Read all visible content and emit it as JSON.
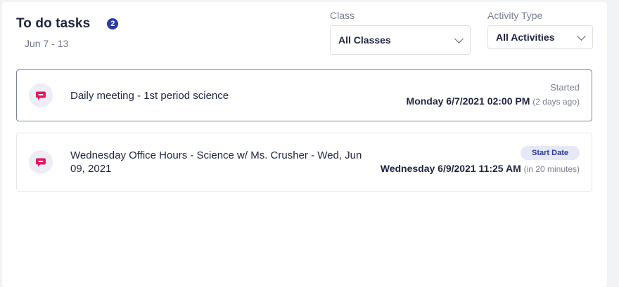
{
  "header": {
    "title": "To do tasks",
    "badge_count": "2",
    "date_range": "Jun 7 - 13"
  },
  "filters": {
    "class": {
      "label": "Class",
      "value": "All Classes"
    },
    "activity_type": {
      "label": "Activity Type",
      "value": "All Activities"
    }
  },
  "tasks": [
    {
      "title": "Daily meeting - 1st period science",
      "status_label": "Started",
      "datetime": "Monday 6/7/2021 02:00 PM",
      "relative": "(2 days ago)"
    },
    {
      "title_line1": "Wednesday Office Hours - Science w/ Ms. Crusher - Wed, Jun",
      "title_line2": "09, 2021",
      "status_label": "Start Date",
      "datetime": "Wednesday 6/9/2021 11:25 AM",
      "relative": "(in 20 minutes)"
    }
  ],
  "colors": {
    "accent": "#2a3a9e",
    "icon_pink": "#e0195f",
    "text_primary": "#1f2540",
    "text_muted": "#7b8192"
  }
}
